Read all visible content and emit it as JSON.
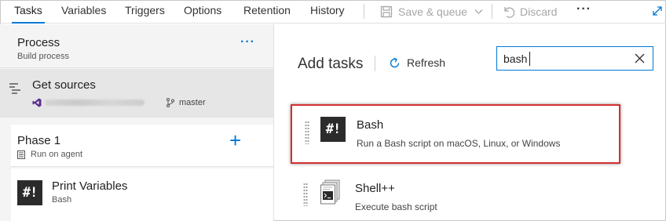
{
  "tabs": [
    {
      "label": "Tasks",
      "active": true
    },
    {
      "label": "Variables"
    },
    {
      "label": "Triggers"
    },
    {
      "label": "Options"
    },
    {
      "label": "Retention"
    },
    {
      "label": "History"
    }
  ],
  "toolbar": {
    "save_label": "Save & queue",
    "discard_label": "Discard",
    "more_label": "···"
  },
  "left": {
    "process": {
      "title": "Process",
      "subtitle": "Build process",
      "more": "···"
    },
    "get_sources": {
      "title": "Get sources",
      "branch": "master"
    },
    "phase": {
      "title": "Phase 1",
      "subtitle": "Run on agent",
      "add": "+"
    },
    "print_variables": {
      "title": "Print Variables",
      "subtitle": "Bash",
      "icon_text": "#!"
    }
  },
  "right": {
    "add_tasks_title": "Add tasks",
    "refresh_label": "Refresh",
    "search": {
      "value": "bash",
      "placeholder": ""
    },
    "results": [
      {
        "title": "Bash",
        "description": "Run a Bash script on macOS, Linux, or Windows",
        "icon_text": "#!",
        "highlighted": true
      },
      {
        "title": "Shell++",
        "description": "Execute bash script",
        "icon": "shell-script-icon"
      }
    ]
  },
  "colors": {
    "accent": "#0078d4",
    "highlight_border": "#d32f2f",
    "left_pane_bg": "#f4f4f4",
    "selected_item_bg": "#e6e6e6",
    "disabled_text": "#a6a6a6"
  }
}
